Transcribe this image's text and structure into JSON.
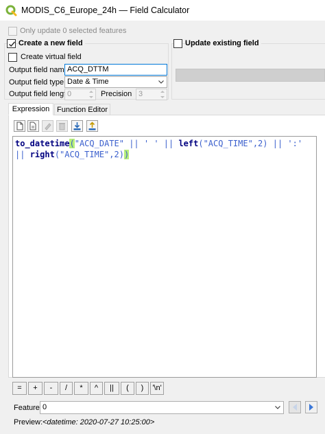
{
  "window": {
    "title": "MODIS_C6_Europe_24h — Field Calculator",
    "logo_icon": "qgis-logo-icon"
  },
  "options": {
    "only_update_label": "Only update 0 selected features",
    "only_update_checked": false,
    "create_new_label": "Create a new field",
    "create_new_checked": true,
    "update_existing_label": "Update existing field",
    "update_existing_checked": false,
    "virtual_label": "Create virtual field",
    "virtual_checked": false
  },
  "form": {
    "output_name_label": "Output field name",
    "output_name_value": "ACQ_DTTM",
    "output_type_label": "Output field type",
    "output_type_value": "Date & Time",
    "output_length_label": "Output field length",
    "output_length_value": "0",
    "precision_label": "Precision",
    "precision_value": "3"
  },
  "tabs": [
    {
      "label": "Expression",
      "active": true
    },
    {
      "label": "Function Editor",
      "active": false
    }
  ],
  "toolbar": {
    "icons": [
      "new-file-icon",
      "open-file-icon",
      "edit-icon",
      "delete-icon",
      "save-icon",
      "export-icon"
    ]
  },
  "expression": {
    "line1": [
      {
        "t": "to_datetime",
        "c": "kw"
      },
      {
        "t": "(",
        "c": "brk"
      },
      {
        "t": "\"ACQ_DATE\" || ' ' || ",
        "c": "str"
      },
      {
        "t": "left",
        "c": "kw"
      },
      {
        "t": "(\"ACQ_TIME\",2) || ':'",
        "c": "str"
      }
    ],
    "line2": [
      {
        "t": "|| ",
        "c": "str"
      },
      {
        "t": "right",
        "c": "kw"
      },
      {
        "t": "(\"ACQ_TIME\",2)",
        "c": "str"
      },
      {
        "t": ")",
        "c": "brk"
      }
    ]
  },
  "operators": [
    "=",
    "+",
    "-",
    "/",
    "*",
    "^",
    "||",
    "(",
    ")",
    "'\\n'"
  ],
  "feature": {
    "label": "Feature",
    "value": "0"
  },
  "preview": {
    "label": "Preview:",
    "value": "<datetime: 2020-07-27 10:25:00>"
  },
  "colors": {
    "keyword": "#000080",
    "string": "#3a5fcd",
    "bracket_highlight": "#b8f07a",
    "focus_border": "#0078d7",
    "nav_arrow": "#3c78d8"
  }
}
